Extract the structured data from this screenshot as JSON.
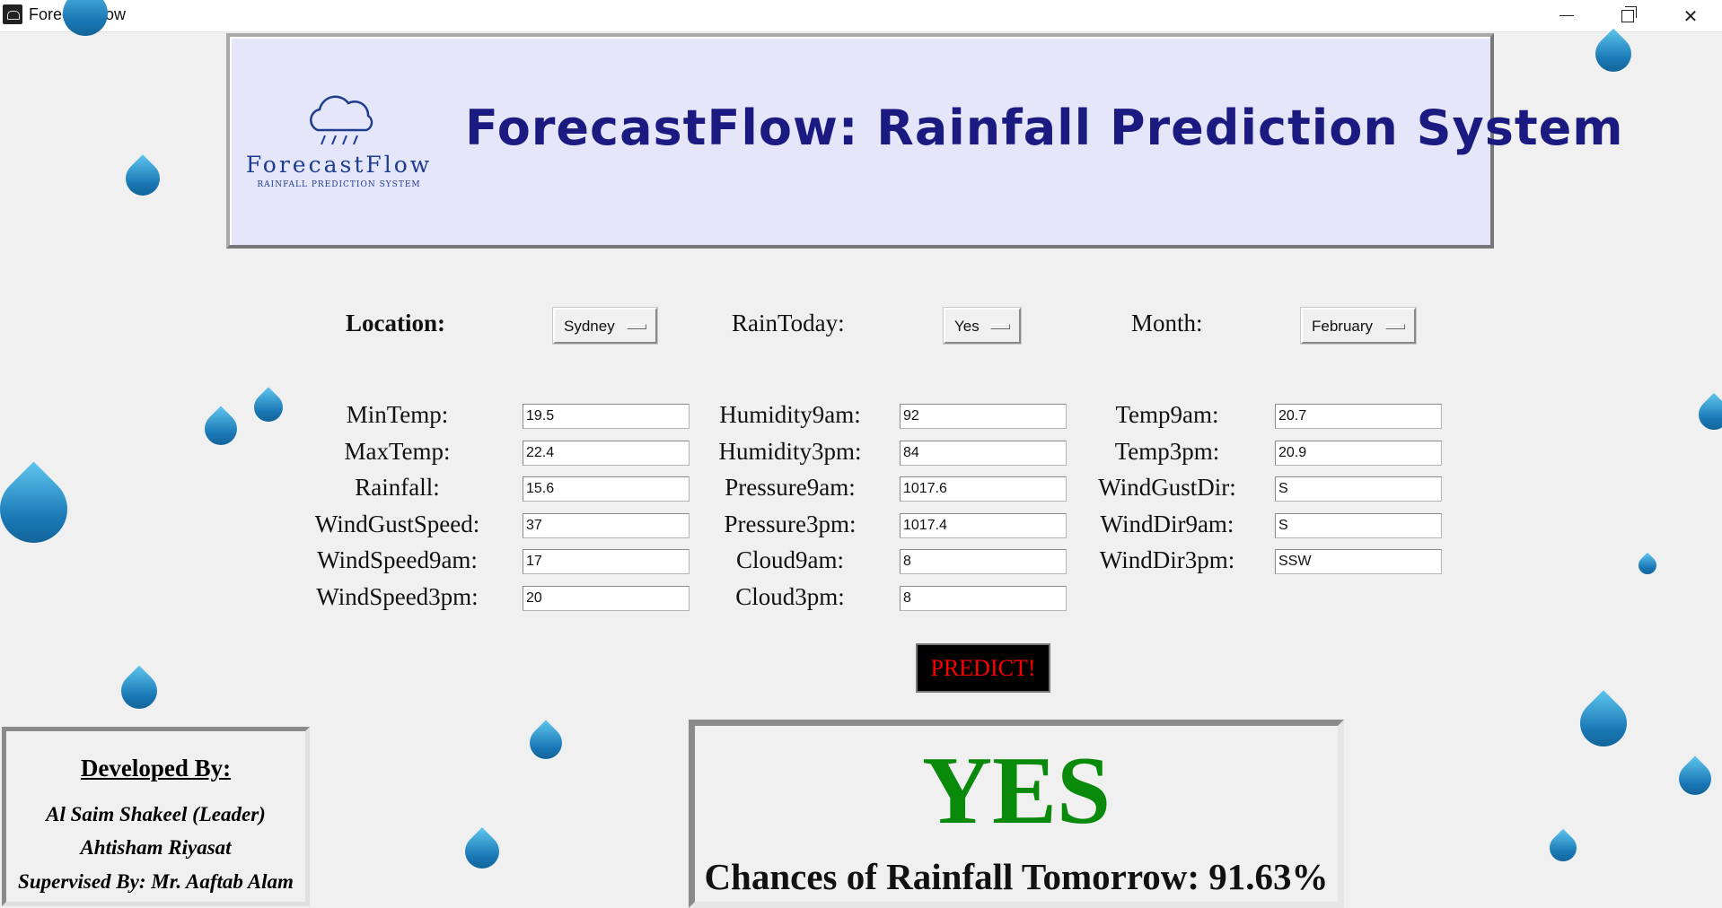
{
  "window": {
    "title": "ForecastFlow"
  },
  "banner": {
    "logo_name": "ForecastFlow",
    "logo_sub": "RAINFALL PREDICTION SYSTEM",
    "title": "ForecastFlow: Rainfall Prediction System"
  },
  "selectors": {
    "location": {
      "label": "Location:",
      "value": "Sydney"
    },
    "rain_today": {
      "label": "RainToday:",
      "value": "Yes"
    },
    "month": {
      "label": "Month:",
      "value": "February"
    }
  },
  "fields": {
    "min_temp": {
      "label": "MinTemp:",
      "value": "19.5"
    },
    "max_temp": {
      "label": "MaxTemp:",
      "value": "22.4"
    },
    "rainfall": {
      "label": "Rainfall:",
      "value": "15.6"
    },
    "wind_gust_speed": {
      "label": "WindGustSpeed:",
      "value": "37"
    },
    "wind_speed_9am": {
      "label": "WindSpeed9am:",
      "value": "17"
    },
    "wind_speed_3pm": {
      "label": "WindSpeed3pm:",
      "value": "20"
    },
    "humidity_9am": {
      "label": "Humidity9am:",
      "value": "92"
    },
    "humidity_3pm": {
      "label": "Humidity3pm:",
      "value": "84"
    },
    "pressure_9am": {
      "label": "Pressure9am:",
      "value": "1017.6"
    },
    "pressure_3pm": {
      "label": "Pressure3pm:",
      "value": "1017.4"
    },
    "cloud_9am": {
      "label": "Cloud9am:",
      "value": "8"
    },
    "cloud_3pm": {
      "label": "Cloud3pm:",
      "value": "8"
    },
    "temp_9am": {
      "label": "Temp9am:",
      "value": "20.7"
    },
    "temp_3pm": {
      "label": "Temp3pm:",
      "value": "20.9"
    },
    "wind_gust_dir": {
      "label": "WindGustDir:",
      "value": "S"
    },
    "wind_dir_9am": {
      "label": "WindDir9am:",
      "value": "S"
    },
    "wind_dir_3pm": {
      "label": "WindDir3pm:",
      "value": "SSW"
    }
  },
  "predict_label": "PREDICT!",
  "developers": {
    "heading": "Developed By:",
    "leader": "Al Saim Shakeel (Leader)",
    "member": "Ahtisham Riyasat",
    "supervisor": "Supervised By: Mr. Aaftab Alam"
  },
  "result": {
    "verdict": "YES",
    "chance_text": "Chances of Rainfall Tomorrow: 91.63%"
  },
  "colors": {
    "banner_bg": "#e6e6fa",
    "title": "#1a1a80",
    "predict_text": "#ff0000",
    "verdict": "#0a8a0a"
  }
}
